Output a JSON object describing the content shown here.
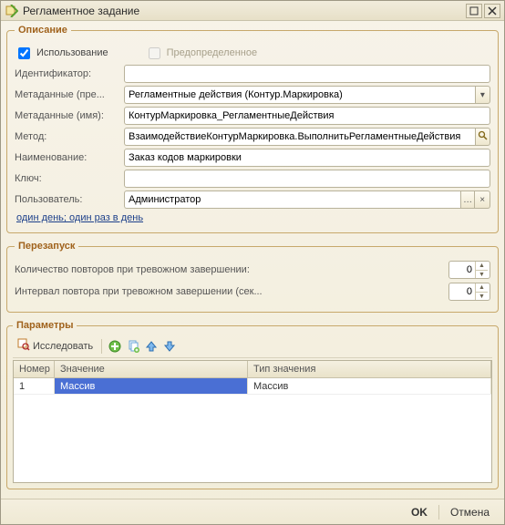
{
  "window": {
    "title": "Регламентное задание"
  },
  "groups": {
    "description": {
      "legend": "Описание"
    },
    "restart": {
      "legend": "Перезапуск"
    },
    "parameters": {
      "legend": "Параметры"
    }
  },
  "description": {
    "usage_label": "Использование",
    "usage_checked": true,
    "predefined_label": "Предопределенное",
    "predefined_checked": false,
    "identifier_label": "Идентификатор:",
    "identifier_value": "",
    "metadata_pre_label": "Метаданные (пре...",
    "metadata_pre_value": "Регламентные действия (Контур.Маркировка)",
    "metadata_name_label": "Метаданные (имя):",
    "metadata_name_value": "КонтурМаркировка_РегламентныеДействия",
    "method_label": "Метод:",
    "method_value": "ВзаимодействиеКонтурМаркировка.ВыполнитьРегламентныеДействия",
    "name_label": "Наименование:",
    "name_value": "Заказ кодов маркировки",
    "key_label": "Ключ:",
    "key_value": "",
    "user_label": "Пользователь:",
    "user_value": "Администратор",
    "schedule_link": "один день; один раз в день"
  },
  "restart": {
    "retries_label": "Количество повторов при тревожном завершении:",
    "retries_value": "0",
    "interval_label": "Интервал повтора при тревожном завершении (сек...",
    "interval_value": "0"
  },
  "parameters": {
    "inspect_label": "Исследовать",
    "columns": {
      "num": "Номер",
      "value": "Значение",
      "type": "Тип значения"
    },
    "rows": [
      {
        "num": "1",
        "value": "Массив",
        "type": "Массив"
      }
    ]
  },
  "footer": {
    "ok": "OK",
    "cancel": "Отмена"
  }
}
